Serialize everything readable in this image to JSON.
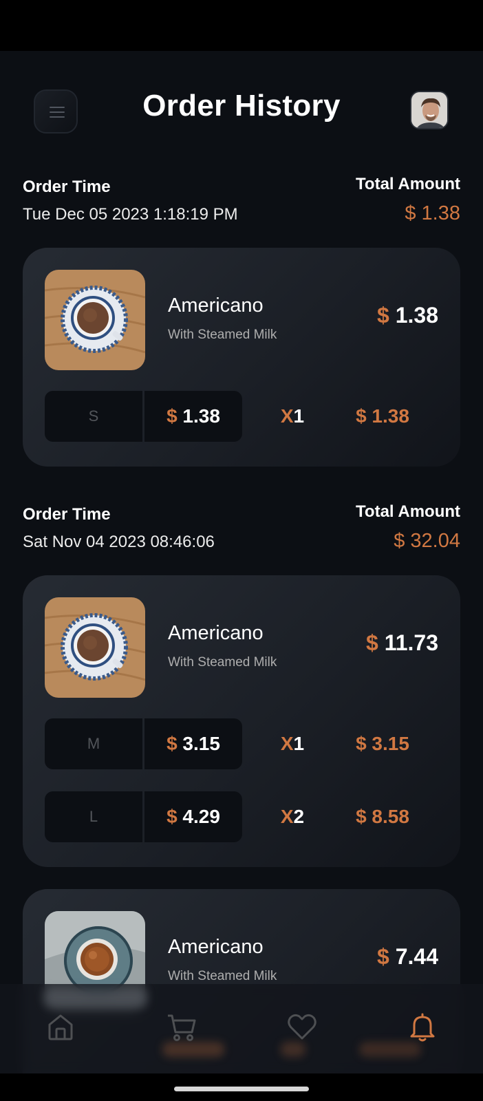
{
  "header": {
    "title": "Order History",
    "menu_icon": "menu-icon",
    "avatar_icon": "user-avatar"
  },
  "orders": [
    {
      "order_time_label": "Order Time",
      "order_time": "Tue Dec 05 2023 1:18:19 PM",
      "total_label": "Total Amount",
      "total": "$ 1.38",
      "items": [
        {
          "name": "Americano",
          "subtitle": "With Steamed Milk",
          "currency": "$",
          "price": "1.38",
          "sizes": [
            {
              "size": "S",
              "currency": "$",
              "price": "1.38",
              "x": "X",
              "qty": "1",
              "total": "$ 1.38"
            }
          ]
        }
      ]
    },
    {
      "order_time_label": "Order Time",
      "order_time": "Sat Nov 04 2023 08:46:06",
      "total_label": "Total Amount",
      "total": "$ 32.04",
      "items": [
        {
          "name": "Americano",
          "subtitle": "With Steamed Milk",
          "currency": "$",
          "price": "11.73",
          "sizes": [
            {
              "size": "M",
              "currency": "$",
              "price": "3.15",
              "x": "X",
              "qty": "1",
              "total": "$ 3.15"
            },
            {
              "size": "L",
              "currency": "$",
              "price": "4.29",
              "x": "X",
              "qty": "2",
              "total": "$ 8.58"
            }
          ]
        },
        {
          "name": "Americano",
          "subtitle": "With Steamed Milk",
          "currency": "$",
          "price": "7.44",
          "sizes": []
        }
      ]
    }
  ],
  "nav": {
    "items": [
      {
        "icon": "home-icon",
        "active": false
      },
      {
        "icon": "cart-icon",
        "active": false
      },
      {
        "icon": "heart-icon",
        "active": false
      },
      {
        "icon": "bell-icon",
        "active": true
      }
    ]
  },
  "colors": {
    "accent": "#D17842",
    "background": "#0C0F14",
    "card": "#1F232A",
    "icon_inactive": "#4E5053"
  }
}
